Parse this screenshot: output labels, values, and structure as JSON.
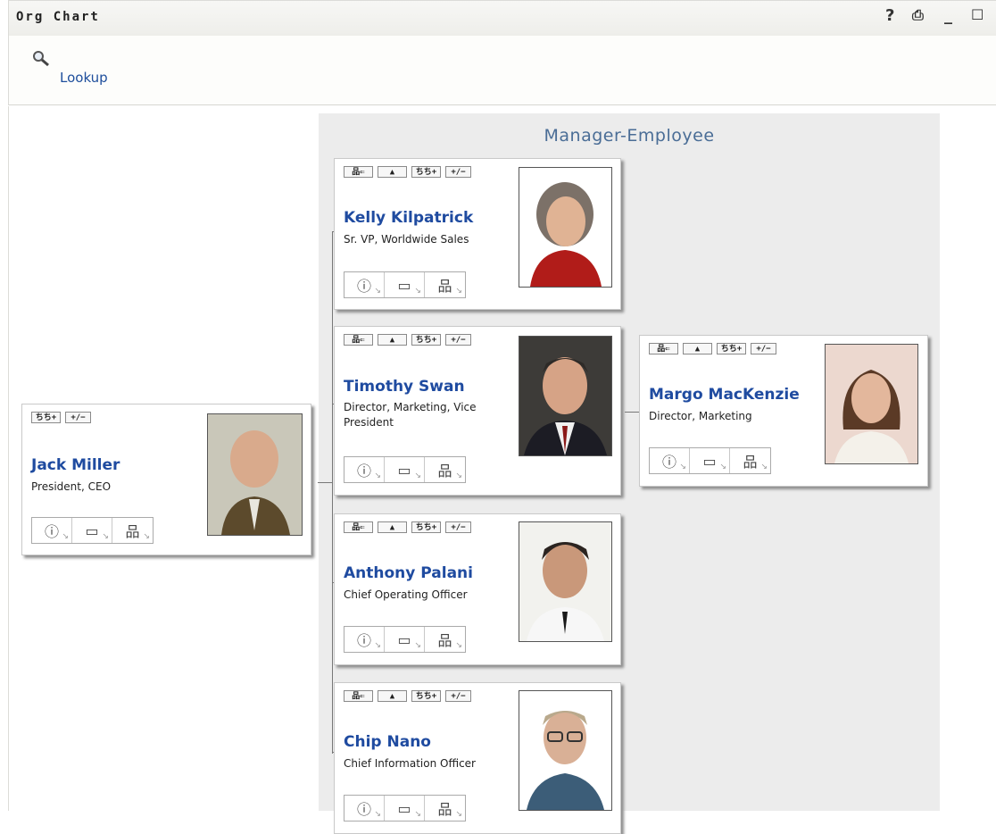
{
  "window": {
    "title": "Org Chart",
    "controls": [
      "?",
      "⎙",
      "_",
      "☐"
    ]
  },
  "toolbar": {
    "lookup_label": "Lookup"
  },
  "view": {
    "panel_title": "Manager-Employee"
  },
  "small_buttons": {
    "go_to_manager": "⇐",
    "up": "▲",
    "expand": "+",
    "toggle": "+/−"
  },
  "root": {
    "name": "Jack Miller",
    "title": "President, CEO",
    "photo_icon": "person-photo"
  },
  "reports": [
    {
      "name": "Kelly Kilpatrick",
      "title": "Sr. VP, Worldwide Sales",
      "photo_icon": "person-photo"
    },
    {
      "name": "Timothy Swan",
      "title": "Director, Marketing, Vice President",
      "photo_icon": "person-photo"
    },
    {
      "name": "Anthony Palani",
      "title": "Chief Operating Officer",
      "photo_icon": "person-photo"
    },
    {
      "name": "Chip Nano",
      "title": "Chief Information Officer",
      "photo_icon": "person-photo"
    }
  ],
  "subreport": {
    "name": "Margo MacKenzie",
    "title": "Director, Marketing",
    "photo_icon": "person-photo"
  },
  "action_icons": [
    "info-icon",
    "email-icon",
    "org-chart-icon"
  ],
  "colors": {
    "name_link": "#1f4ba0",
    "panel_title": "#4a6d96",
    "panel_bg": "#ececec"
  }
}
